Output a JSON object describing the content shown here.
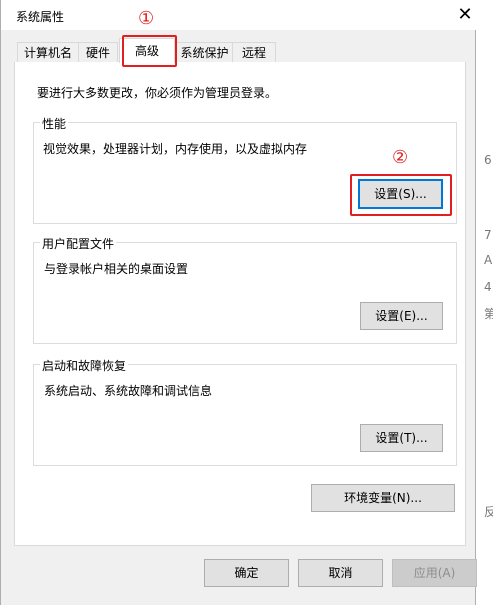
{
  "window": {
    "title": "系统属性",
    "close_glyph": "✕"
  },
  "tabs": [
    {
      "label": "计算机名"
    },
    {
      "label": "硬件"
    },
    {
      "label": "高级"
    },
    {
      "label": "系统保护"
    },
    {
      "label": "远程"
    }
  ],
  "admin_notice": "要进行大多数更改，你必须作为管理员登录。",
  "performance": {
    "label": "性能",
    "description": "视觉效果，处理器计划，内存使用，以及虚拟内存",
    "button": "设置(S)..."
  },
  "user_profiles": {
    "label": "用户配置文件",
    "description": "与登录帐户相关的桌面设置",
    "button": "设置(E)..."
  },
  "startup_recovery": {
    "label": "启动和故障恢复",
    "description": "系统启动、系统故障和调试信息",
    "button": "设置(T)..."
  },
  "env_button": "环境变量(N)...",
  "footer": {
    "ok": "确定",
    "cancel": "取消",
    "apply": "应用(A)"
  },
  "annotations": {
    "marker1": "①",
    "marker2": "②",
    "color": "#e02020"
  },
  "background_fragments": [
    "6",
    "7",
    "A",
    "4",
    "第",
    "反"
  ]
}
